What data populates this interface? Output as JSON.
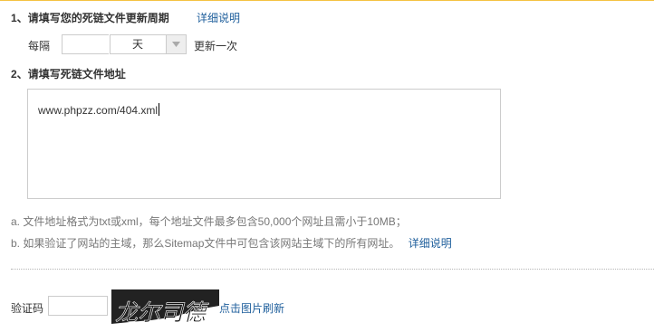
{
  "section1": {
    "number": "1、",
    "title": "请填写您的死链文件更新周期",
    "help_link": "详细说明",
    "every_label": "每隔",
    "period_value": "",
    "unit_selected": "天",
    "suffix": "更新一次"
  },
  "section2": {
    "number": "2、",
    "title": "请填写死链文件地址",
    "url_value": "www.phpzz.com/404.xml"
  },
  "notes": {
    "a": "a. 文件地址格式为txt或xml，每个地址文件最多包含50,000个网址且需小于10MB；",
    "b": "b. 如果验证了网站的主域，那么Sitemap文件中可包含该网站主域下的所有网址。",
    "b_link": "详细说明"
  },
  "captcha": {
    "label": "验证码",
    "input_value": "",
    "image_text": "龙尔司德",
    "refresh_link": "点击图片刷新"
  },
  "colors": {
    "top_border": "#f5c242",
    "link": "#1f5f9c",
    "captcha_bg": "#222222"
  }
}
